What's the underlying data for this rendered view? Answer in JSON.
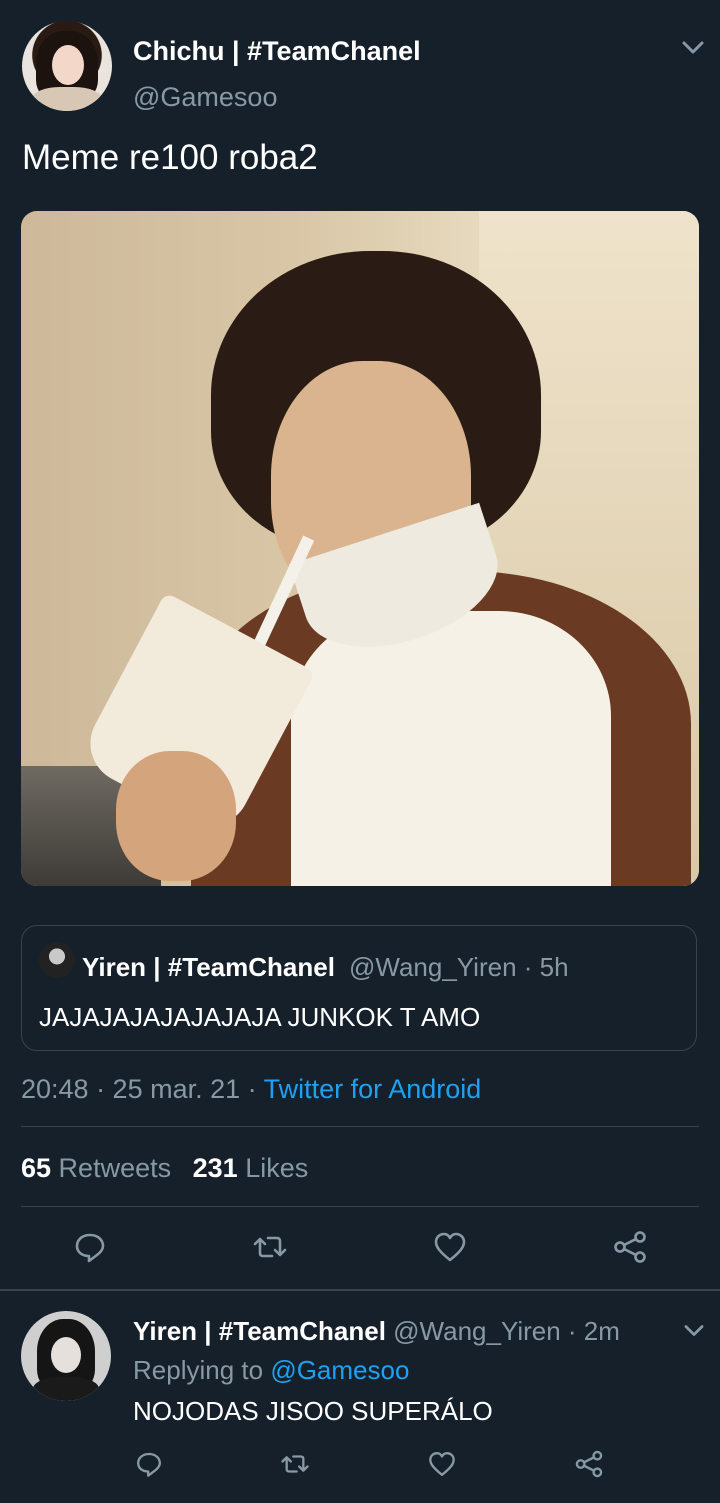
{
  "tweet": {
    "author_name": "Chichu | #TeamChanel",
    "author_handle": "@Gamesoo",
    "text": "Meme re100 roba2",
    "quoted": {
      "name": "Yiren | #TeamChanel",
      "handle_time": "@Wang_Yiren · 5h",
      "text": "JAJAJAJAJAJAJAJA JUNKOK T AMO"
    },
    "time_date": "20:48 · 25 mar. 21 · ",
    "source": "Twitter for Android",
    "retweets_count": "65",
    "retweets_label": " Retweets",
    "likes_count": "231",
    "likes_label": " Likes"
  },
  "reply": {
    "name": "Yiren | #TeamChanel",
    "handle_time": "@Wang_Yiren · 2m",
    "replying_prefix": "Replying to ",
    "replying_handle": "@Gamesoo",
    "text": "NOJODAS JISOO SUPERÁLO"
  },
  "icons": {
    "more": "chevron-down-icon",
    "reply": "reply-icon",
    "retweet": "retweet-icon",
    "like": "heart-icon",
    "share": "share-icon"
  },
  "colors": {
    "background": "#15202b",
    "text": "#ffffff",
    "muted": "#8899a6",
    "link": "#1da1f2",
    "border": "#38444d"
  }
}
